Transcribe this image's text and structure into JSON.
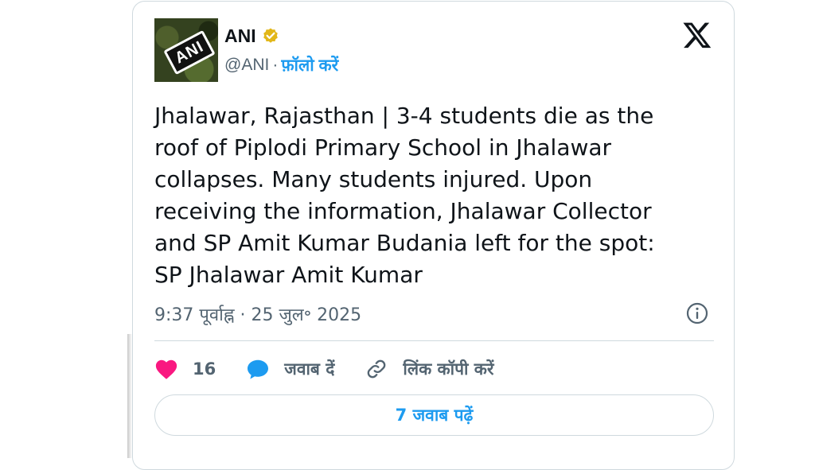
{
  "author": {
    "name": "ANI",
    "handle": "@ANI",
    "avatar_text": "ANI",
    "separator": "·",
    "follow_label": "फ़ॉलो करें"
  },
  "tweet": {
    "text": "Jhalawar, Rajasthan | 3-4 students die as the\nroof of Piplodi Primary School in Jhalawar\ncollapses. Many students injured. Upon\nreceiving the information, Jhalawar Collector\nand SP Amit Kumar Budania left for the spot:\nSP Jhalawar Amit Kumar",
    "timestamp": "9:37 पूर्वाह्न · 25 जुल॰ 2025"
  },
  "actions": {
    "like_count": "16",
    "reply_label": "जवाब दें",
    "copy_link_label": "लिंक कॉपी करें"
  },
  "replies_button": {
    "label": "7 जवाब पढ़ें"
  },
  "icons": {
    "verified": "verified-badge-icon",
    "platform": "x-logo-icon",
    "info": "info-icon",
    "like": "heart-icon",
    "reply": "speech-bubble-icon",
    "link": "link-icon"
  },
  "colors": {
    "accent": "#1d9bf0",
    "verified": "#e2b719",
    "like": "#f91880",
    "text": "#0f1419",
    "muted": "#536471",
    "border": "#cfd9de"
  }
}
